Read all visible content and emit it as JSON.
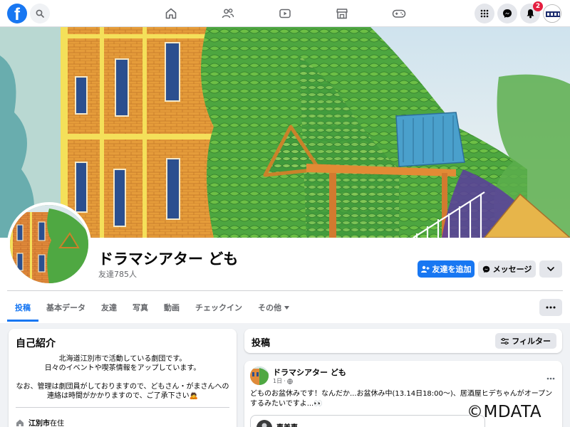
{
  "nav": {
    "logo": "f",
    "notification_count": "2",
    "icons": [
      "search-icon",
      "home-icon",
      "friends-icon",
      "watch-icon",
      "marketplace-icon",
      "gaming-icon",
      "menu-grid-icon",
      "messenger-icon",
      "bell-icon"
    ]
  },
  "profile": {
    "name": "ドラマシアター ども",
    "friends": "友達785人",
    "add_friend_label": "友達を追加",
    "message_label": "メッセージ"
  },
  "tabs": [
    {
      "label": "投稿",
      "active": true
    },
    {
      "label": "基本データ"
    },
    {
      "label": "友達"
    },
    {
      "label": "写真"
    },
    {
      "label": "動画"
    },
    {
      "label": "チェックイン"
    },
    {
      "label": "その他"
    }
  ],
  "intro": {
    "title": "自己紹介",
    "bio_line1": "北海道江別市で活動している劇団です。",
    "bio_line2": "日々のイベントや喫茶情報をアップしています。",
    "bio_line3": "なお、管理は劇団員がしておりますので、どもさん・がまさんへの",
    "bio_line4": "連絡は時間がかかりますので、ご了承下さい🙇",
    "residence_city": "江別市",
    "residence_suffix": "在住"
  },
  "posts": {
    "title": "投稿",
    "filter_label": "フィルター"
  },
  "post": {
    "author": "ドラマシアター ども",
    "time": "1日",
    "text": "どものお盆休みです！なんだか...お盆休み中(13.14日18:00〜)、居酒屋ヒデちゃんがオープンするみたいですよ...👀",
    "shared_name": "恵美恵"
  },
  "watermark": "©MDATA",
  "colors": {
    "brand": "#1877f2",
    "background": "#f0f2f5",
    "badge": "#e41e3f"
  }
}
